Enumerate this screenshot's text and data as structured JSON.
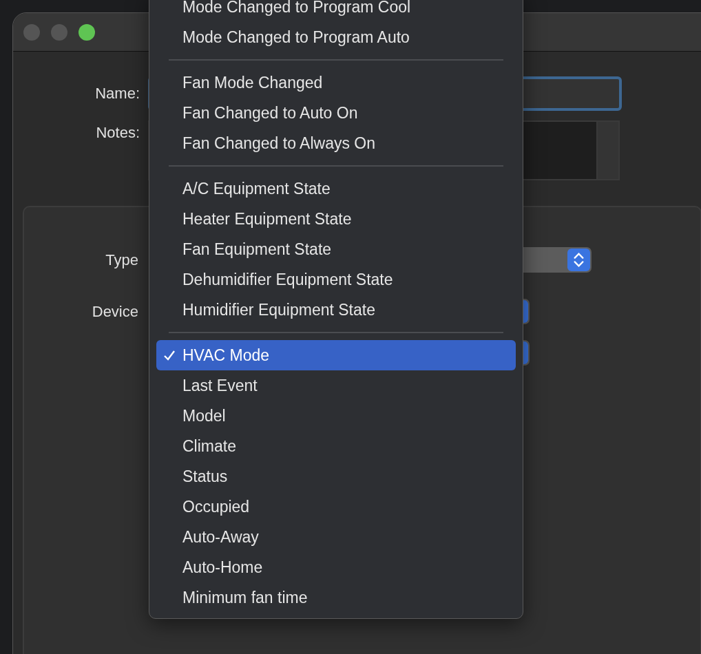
{
  "window": {
    "controls": [
      {
        "active": false
      },
      {
        "active": false
      },
      {
        "active": true
      }
    ]
  },
  "form": {
    "name_label": "Name:",
    "name_focused": true,
    "notes_label": "Notes:"
  },
  "group": {
    "labels": [
      "Type",
      "Device"
    ]
  },
  "menu": {
    "groups": [
      [
        {
          "label": "Mode Changed to Program Cool",
          "checked": false,
          "selected": false
        },
        {
          "label": "Mode Changed to Program Auto",
          "checked": false,
          "selected": false
        }
      ],
      [
        {
          "label": "Fan Mode Changed",
          "checked": false,
          "selected": false
        },
        {
          "label": "Fan Changed to Auto On",
          "checked": false,
          "selected": false
        },
        {
          "label": "Fan Changed to Always On",
          "checked": false,
          "selected": false
        }
      ],
      [
        {
          "label": "A/C Equipment State",
          "checked": false,
          "selected": false
        },
        {
          "label": "Heater Equipment State",
          "checked": false,
          "selected": false
        },
        {
          "label": "Fan Equipment State",
          "checked": false,
          "selected": false
        },
        {
          "label": "Dehumidifier Equipment State",
          "checked": false,
          "selected": false
        },
        {
          "label": "Humidifier Equipment State",
          "checked": false,
          "selected": false
        }
      ],
      [
        {
          "label": "HVAC Mode",
          "checked": true,
          "selected": true
        },
        {
          "label": "Last Event",
          "checked": false,
          "selected": false
        },
        {
          "label": "Model",
          "checked": false,
          "selected": false
        },
        {
          "label": "Climate",
          "checked": false,
          "selected": false
        },
        {
          "label": "Status",
          "checked": false,
          "selected": false
        },
        {
          "label": "Occupied",
          "checked": false,
          "selected": false
        },
        {
          "label": "Auto-Away",
          "checked": false,
          "selected": false
        },
        {
          "label": "Auto-Home",
          "checked": false,
          "selected": false
        },
        {
          "label": "Minimum fan time",
          "checked": false,
          "selected": false
        }
      ]
    ]
  }
}
